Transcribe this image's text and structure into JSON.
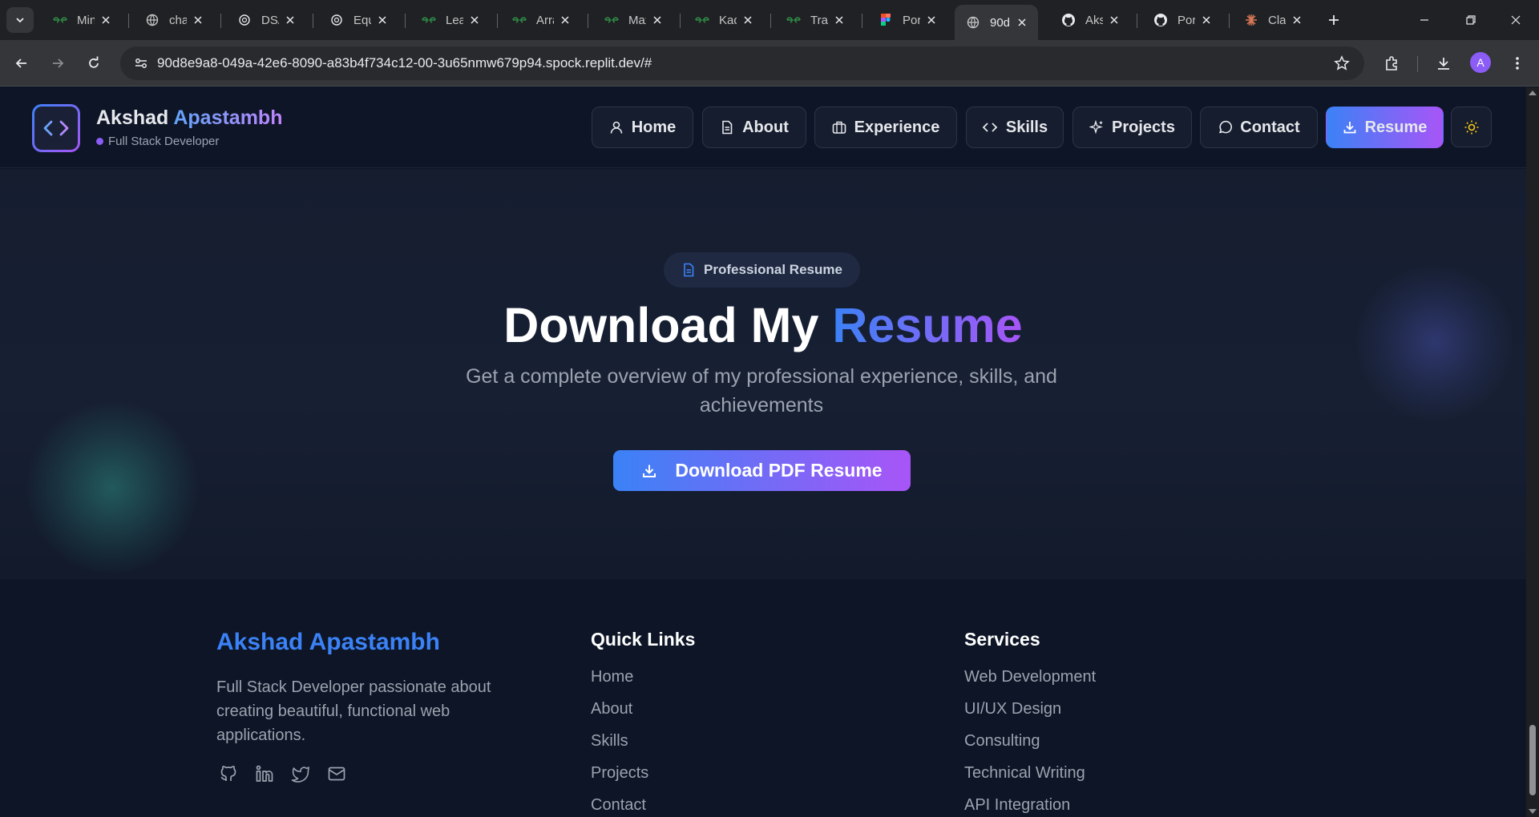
{
  "browser": {
    "tabs": [
      {
        "title": "Min",
        "favicon": "gfg-icon"
      },
      {
        "title": "chat",
        "favicon": "globe-icon"
      },
      {
        "title": "DSA",
        "favicon": "openai-icon"
      },
      {
        "title": "Equ",
        "favicon": "openai-icon"
      },
      {
        "title": "Lear",
        "favicon": "gfg-icon"
      },
      {
        "title": "Arra",
        "favicon": "gfg-icon"
      },
      {
        "title": "Max",
        "favicon": "gfg-icon"
      },
      {
        "title": "Kad",
        "favicon": "gfg-icon"
      },
      {
        "title": "Trap",
        "favicon": "gfg-icon"
      },
      {
        "title": "Port",
        "favicon": "figma-icon"
      },
      {
        "title": "90d",
        "favicon": "globe-icon",
        "active": true
      },
      {
        "title": "Aks",
        "favicon": "github-icon"
      },
      {
        "title": "Port",
        "favicon": "github-icon"
      },
      {
        "title": "Clau",
        "favicon": "claude-icon"
      }
    ],
    "url": "90d8e9a8-049a-42e6-8090-a83b4f734c12-00-3u65nmw679p94.spock.replit.dev/#",
    "profile_initial": "A"
  },
  "header": {
    "brand_first": "Akshad",
    "brand_last": "Apastambh",
    "role": "Full Stack Developer",
    "nav": {
      "home": "Home",
      "about": "About",
      "experience": "Experience",
      "skills": "Skills",
      "projects": "Projects",
      "contact": "Contact",
      "resume": "Resume"
    }
  },
  "hero": {
    "badge": "Professional Resume",
    "title_plain": "Download My",
    "title_accent": "Resume",
    "subtitle": "Get a complete overview of my professional experience, skills, and achievements",
    "button": "Download PDF Resume"
  },
  "footer": {
    "brand": "Akshad Apastambh",
    "description": "Full Stack Developer passionate about creating beautiful, functional web applications.",
    "quick_links": {
      "heading": "Quick Links",
      "items": [
        "Home",
        "About",
        "Skills",
        "Projects",
        "Contact"
      ]
    },
    "services": {
      "heading": "Services",
      "items": [
        "Web Development",
        "UI/UX Design",
        "Consulting",
        "Technical Writing",
        "API Integration"
      ]
    }
  },
  "colors": {
    "accent_blue": "#3b82f6",
    "accent_purple": "#a855f7",
    "page_bg": "#0b1223"
  }
}
